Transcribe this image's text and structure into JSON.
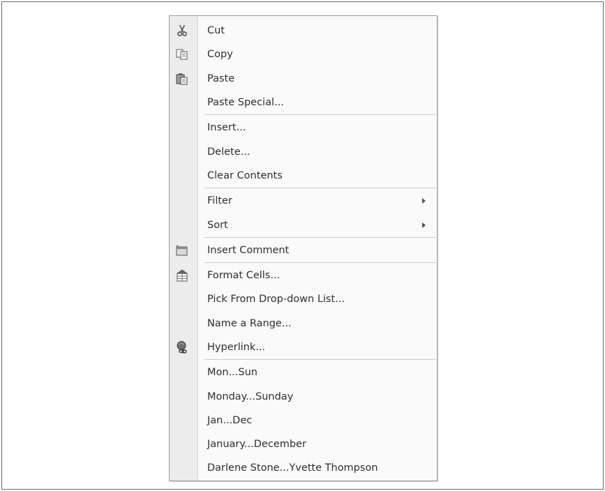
{
  "context_menu": {
    "items": [
      {
        "label": "Cut",
        "icon": "scissors-icon"
      },
      {
        "label": "Copy",
        "icon": "copy-icon"
      },
      {
        "label": "Paste",
        "icon": "paste-icon"
      },
      {
        "label": "Paste Special...",
        "icon": ""
      },
      {
        "label": "Insert...",
        "icon": ""
      },
      {
        "label": "Delete...",
        "icon": ""
      },
      {
        "label": "Clear Contents",
        "icon": ""
      },
      {
        "label": "Filter",
        "icon": "",
        "submenu": true
      },
      {
        "label": "Sort",
        "icon": "",
        "submenu": true
      },
      {
        "label": "Insert Comment",
        "icon": "comment-icon"
      },
      {
        "label": "Format Cells...",
        "icon": "format-cells-icon"
      },
      {
        "label": "Pick From Drop-down List...",
        "icon": ""
      },
      {
        "label": "Name a Range...",
        "icon": ""
      },
      {
        "label": "Hyperlink...",
        "icon": "hyperlink-icon"
      },
      {
        "label": "Mon...Sun",
        "icon": ""
      },
      {
        "label": "Monday...Sunday",
        "icon": ""
      },
      {
        "label": "Jan...Dec",
        "icon": ""
      },
      {
        "label": "January...December",
        "icon": ""
      },
      {
        "label": "Darlene Stone...Yvette Thompson",
        "icon": ""
      }
    ]
  }
}
